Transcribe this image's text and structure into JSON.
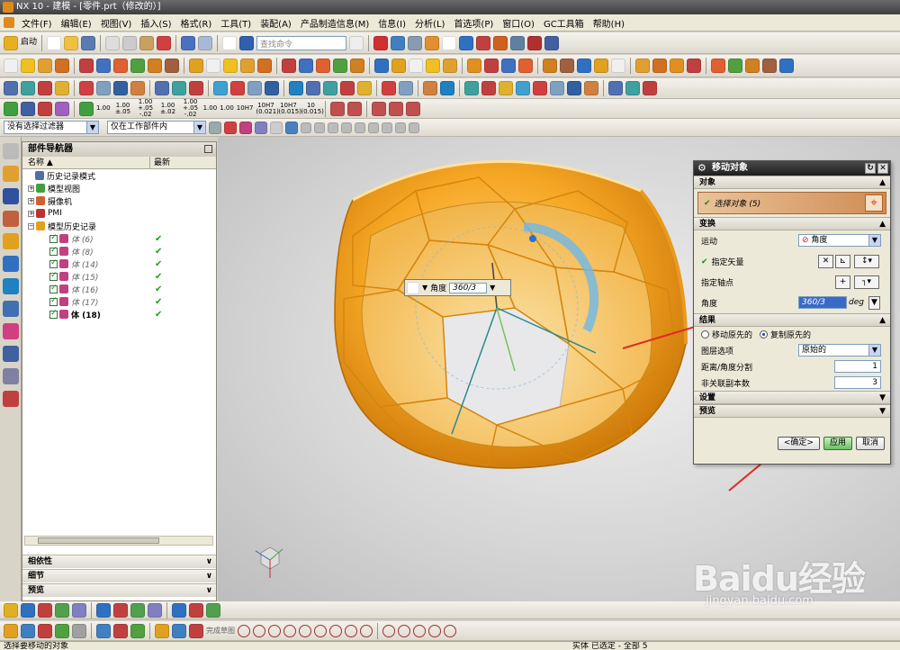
{
  "window": {
    "title": "NX 10 - 建模 - [零件.prt（修改的）]"
  },
  "menu": [
    "文件(F)",
    "编辑(E)",
    "视图(V)",
    "插入(S)",
    "格式(R)",
    "工具(T)",
    "装配(A)",
    "产品制造信息(M)",
    "信息(I)",
    "分析(L)",
    "首选项(P)",
    "窗口(O)",
    "GC工具箱",
    "帮助(H)"
  ],
  "toolbar": {
    "start_label": "启动",
    "search_placeholder": "查找命令",
    "filter_value": "没有选择过滤器",
    "scope_value": "仅在工作部件内",
    "dim_labels": [
      "1.00",
      "1.00 ±.05",
      "1.00 +.05 -.02",
      "1.00 ±.02",
      "1.00 +.05 -.02",
      "1.00",
      "1.00",
      "10H7",
      "10H7 (0.021)",
      "10H7 (0.015)",
      "10 (0.015)"
    ]
  },
  "navigator": {
    "title": "部件导航器",
    "col_name": "名称",
    "col_latest": "最新",
    "items": [
      {
        "label": "历史记录模式",
        "level": 1
      },
      {
        "label": "模型视图",
        "level": 0
      },
      {
        "label": "摄像机",
        "level": 0
      },
      {
        "label": "PMI",
        "level": 0
      },
      {
        "label": "模型历史记录",
        "level": 0
      },
      {
        "label": "体 (6)",
        "level": 2,
        "latest": "✔"
      },
      {
        "label": "体 (8)",
        "level": 2,
        "latest": "✔"
      },
      {
        "label": "体 (14)",
        "level": 2,
        "latest": "✔"
      },
      {
        "label": "体 (15)",
        "level": 2,
        "latest": "✔"
      },
      {
        "label": "体 (16)",
        "level": 2,
        "latest": "✔"
      },
      {
        "label": "体 (17)",
        "level": 2,
        "latest": "✔"
      },
      {
        "label": "体 (18)",
        "level": 2,
        "latest": "✔"
      }
    ],
    "sections": [
      "相依性",
      "细节",
      "预览"
    ]
  },
  "floating_input": {
    "label": "角度",
    "value": "360/3"
  },
  "dialog": {
    "title": "移动对象",
    "sec_object": "对象",
    "select_label": "选择对象 (5)",
    "sec_transform": "变换",
    "motion_label": "运动",
    "motion_value": "角度",
    "vector_label": "指定矢量",
    "pivot_label": "指定轴点",
    "angle_label": "角度",
    "angle_value": "360/3",
    "angle_unit": "deg",
    "sec_result": "结果",
    "radio_move": "移动原先的",
    "radio_copy": "复制原先的",
    "layer_label": "图层选项",
    "layer_value": "原始的",
    "dist_label": "距离/角度分割",
    "dist_value": "1",
    "copies_label": "非关联副本数",
    "copies_value": "3",
    "sec_settings": "设置",
    "sec_preview": "预览",
    "ok": "<确定>",
    "apply": "应用",
    "cancel": "取消"
  },
  "bottom": {
    "sketch_label": "完成草图"
  },
  "status": {
    "left": "选择要移动的对象",
    "right": "实体 已选定 - 全部 5"
  },
  "watermark": {
    "brand": "Baidu经验",
    "url": "jingyan.baidu.com"
  },
  "colors": {
    "ball": "#f5a623",
    "accent": "#e08a1c",
    "dialog_title": "#2a2a2a"
  }
}
